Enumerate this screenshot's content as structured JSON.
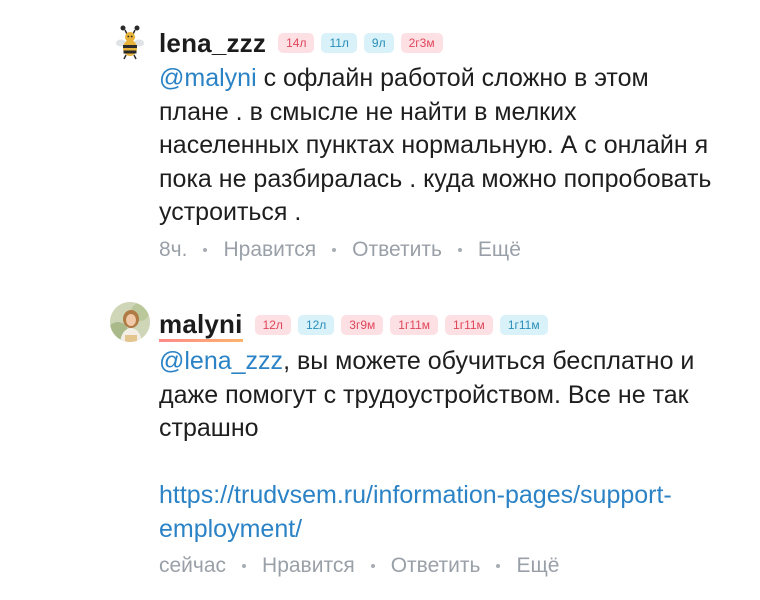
{
  "comments": [
    {
      "username": "lena_zzz",
      "badges": [
        {
          "label": "14л",
          "color": "pink"
        },
        {
          "label": "11л",
          "color": "blue"
        },
        {
          "label": "9л",
          "color": "blue"
        },
        {
          "label": "2г3м",
          "color": "pink"
        }
      ],
      "mention": "@malyni",
      "text": " с офлайн работой сложно в этом плане . в смысле не найти в мелких населенных пунктах нормальную. А с онлайн я пока не разбиралась . куда можно попробовать устроиться .",
      "time": "8ч.",
      "like": "Нравится",
      "reply": "Ответить",
      "more": "Ещё"
    },
    {
      "username": "malyni",
      "badges": [
        {
          "label": "12л",
          "color": "pink"
        },
        {
          "label": "12л",
          "color": "blue"
        },
        {
          "label": "3г9м",
          "color": "pink"
        },
        {
          "label": "1г11м",
          "color": "pink"
        },
        {
          "label": "1г11м",
          "color": "pink"
        },
        {
          "label": "1г11м",
          "color": "blue"
        }
      ],
      "mention": "@lena_zzz",
      "text": ", вы можете обучиться бесплатно и даже помогут с трудоустройством. Все не так страшно",
      "link": "https://trudvsem.ru/information-pages/support-employment/",
      "time": "сейчас",
      "like": "Нравится",
      "reply": "Ответить",
      "more": "Ещё"
    }
  ],
  "colors": {
    "mention": "#2b83c6",
    "badge_pink_bg": "#fde0e3",
    "badge_pink_text": "#e0465a",
    "badge_blue_bg": "#d9f1f9",
    "badge_blue_text": "#2a8fb8",
    "meta": "#9aa0a8"
  },
  "icons": {
    "avatar_1": "bee-avatar",
    "avatar_2": "woman-photo-avatar"
  }
}
